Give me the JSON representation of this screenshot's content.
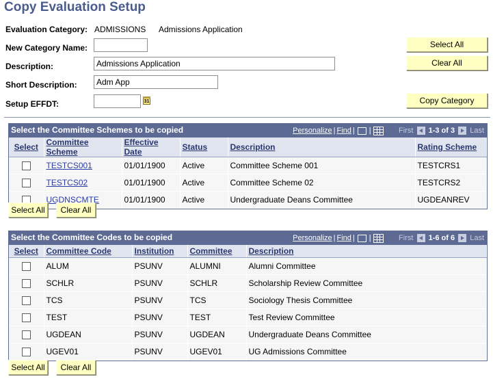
{
  "page": {
    "title": "Copy Evaluation Setup"
  },
  "form": {
    "evaluation_category_label": "Evaluation Category:",
    "evaluation_category_code": "ADMISSIONS",
    "evaluation_category_desc": "Admissions Application",
    "new_category_name_label": "New Category Name:",
    "new_category_name_value": "",
    "description_label": "Description:",
    "description_value": "Admissions Application",
    "short_description_label": "Short Description:",
    "short_description_value": "Adm App",
    "setup_effdt_label": "Setup EFFDT:",
    "setup_effdt_value": "",
    "calendar_icon_glyph": "31"
  },
  "buttons": {
    "select_all": "Select All",
    "clear_all": "Clear All",
    "copy_category": "Copy Category"
  },
  "schemes_grid": {
    "title": "Select the Committee Schemes to be copied",
    "personalize": "Personalize",
    "find": "Find",
    "first": "First",
    "range": "1-3 of 3",
    "last": "Last",
    "columns": [
      "Select",
      "Committee Scheme",
      "Effective Date",
      "Status",
      "Description",
      "Rating Scheme"
    ],
    "rows": [
      {
        "scheme": "TESTCS001",
        "effdt": "01/01/1900",
        "status": "Active",
        "description": "Committee Scheme 001",
        "rating": "TESTCRS1"
      },
      {
        "scheme": "TESTCS02",
        "effdt": "01/01/1900",
        "status": "Active",
        "description": "Committee Scheme 02",
        "rating": "TESTCRS2"
      },
      {
        "scheme": "UGDNSCMTE",
        "effdt": "01/01/1900",
        "status": "Active",
        "description": "Undergraduate Deans Committee",
        "rating": "UGDEANREV"
      }
    ],
    "select_all": "Select All",
    "clear_all": "Clear All"
  },
  "codes_grid": {
    "title": "Select the Committee Codes to be copied",
    "personalize": "Personalize",
    "find": "Find",
    "first": "First",
    "range": "1-6 of 6",
    "last": "Last",
    "columns": [
      "Select",
      "Committee Code",
      "Institution",
      "Committee",
      "Description"
    ],
    "rows": [
      {
        "code": "ALUM",
        "institution": "PSUNV",
        "committee": "ALUMNI",
        "description": "Alumni Committee"
      },
      {
        "code": "SCHLR",
        "institution": "PSUNV",
        "committee": "SCHLR",
        "description": "Scholarship Review Committee"
      },
      {
        "code": "TCS",
        "institution": "PSUNV",
        "committee": "TCS",
        "description": "Sociology Thesis Committee"
      },
      {
        "code": "TEST",
        "institution": "PSUNV",
        "committee": "TEST",
        "description": "Test Review Committee"
      },
      {
        "code": "UGDEAN",
        "institution": "PSUNV",
        "committee": "UGDEAN",
        "description": "Undergraduate Deans Committee"
      },
      {
        "code": "UGEV01",
        "institution": "PSUNV",
        "committee": "UGEV01",
        "description": "UG Admissions Committee"
      }
    ],
    "select_all": "Select All",
    "clear_all": "Clear All"
  },
  "colors": {
    "title": "#4a5c8c",
    "grid_header": "#5c6a94",
    "button_bg": "#ffffc2",
    "link": "#2a3ca8"
  }
}
